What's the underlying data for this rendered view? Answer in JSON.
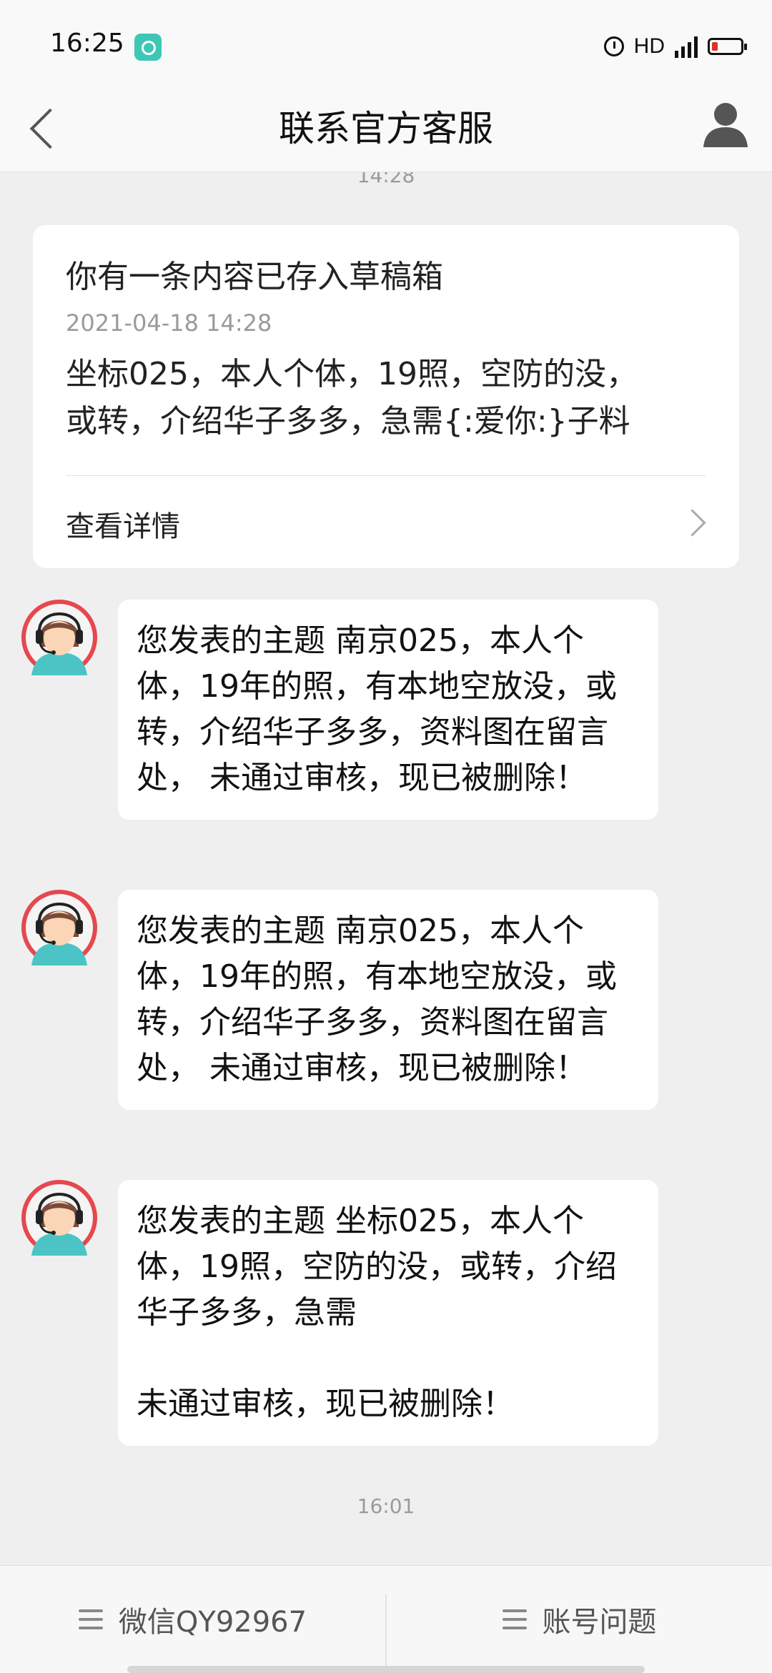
{
  "status_bar": {
    "time": "16:25",
    "network": "HD",
    "network_type": "4G",
    "icons": [
      "app-icon",
      "alarm-icon",
      "signal-icon",
      "battery-icon"
    ]
  },
  "header": {
    "title": "联系官方客服",
    "back_icon": "chevron-left-icon",
    "profile_icon": "user-icon"
  },
  "chat": {
    "top_timestamp": "14:28",
    "draft_card": {
      "title": "你有一条内容已存入草稿箱",
      "date": "2021-04-18 14:28",
      "body": "坐标025，本人个体，19照，空防的没，\n或转，介绍华子多多，急需{:爱你:}子料",
      "link_label": "查看详情"
    },
    "messages": [
      {
        "sender": "support-agent",
        "text": "您发表的主题 南京025，本人个体，19年的照，有本地空放没，或转，介绍华子多多，资料图在留言处， 未通过审核，现已被删除！"
      },
      {
        "sender": "support-agent",
        "text": "您发表的主题 南京025，本人个体，19年的照，有本地空放没，或转，介绍华子多多，资料图在留言处， 未通过审核，现已被删除！"
      },
      {
        "sender": "support-agent",
        "text": "您发表的主题 坐标025，本人个体，19照，空防的没，或转，介绍华子多多，急需\n\n未通过审核，现已被删除！"
      }
    ],
    "bottom_timestamp": "16:01"
  },
  "tab_bar": {
    "items": [
      {
        "label": "微信QY92967",
        "icon": "menu-icon"
      },
      {
        "label": "账号问题",
        "icon": "menu-icon"
      }
    ]
  },
  "colors": {
    "background": "#efefef",
    "card": "#ffffff",
    "app_icon": "#3fc7b6",
    "battery_low": "#e03030",
    "avatar_ring": "#e5484d",
    "avatar_shirt": "#4cc4c6"
  }
}
